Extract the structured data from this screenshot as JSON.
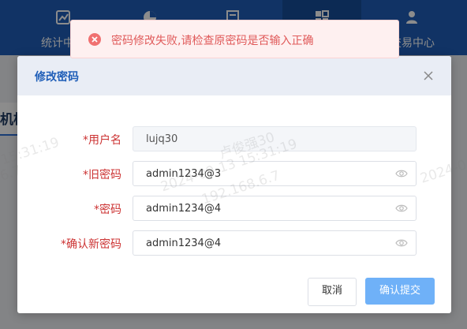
{
  "nav": {
    "items": [
      {
        "label": "统计中心",
        "icon": "chart-icon"
      },
      {
        "label": "",
        "icon": "pie-chart-icon"
      },
      {
        "label": "",
        "icon": "document-icon"
      },
      {
        "label": "",
        "icon": "grid-icon"
      },
      {
        "label": "交易中心",
        "icon": "user-settings-icon"
      }
    ]
  },
  "background": {
    "tab_label": "机构"
  },
  "toast": {
    "message": "密码修改失败,请检查原密码是否输入正确",
    "icon": "error-circle-icon",
    "color": "#e05a5a"
  },
  "dialog": {
    "title": "修改密码",
    "close_icon": "close-icon",
    "fields": {
      "username": {
        "label": "*用户名",
        "value": "lujq30"
      },
      "old_password": {
        "label": "*旧密码",
        "value": "admin1234@3"
      },
      "password": {
        "label": "*密码",
        "value": "admin1234@4"
      },
      "confirm_password": {
        "label": "*确认新密码",
        "value": "admin1234@4"
      }
    },
    "buttons": {
      "cancel": "取消",
      "submit": "确认提交"
    }
  },
  "watermark": {
    "name": "卢俊强30",
    "datetime": "2024-09-13 15:31:19",
    "ip": "192.168.6.7",
    "fragments": [
      "15:31:19",
      "2024-0",
      "6.7"
    ]
  },
  "colors": {
    "primary": "#1f5eb8",
    "submit": "#6fb1f8",
    "label_required": "#cc3333"
  }
}
